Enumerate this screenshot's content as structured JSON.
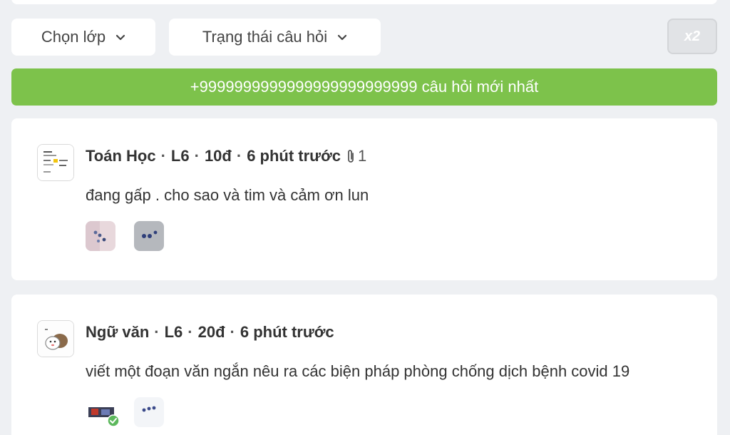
{
  "filters": {
    "class_label": "Chọn lớp",
    "status_label": "Trạng thái câu hỏi",
    "x2_label": "x2"
  },
  "banner": {
    "text": "+9999999999999999999999999 câu hỏi mới nhất"
  },
  "questions": [
    {
      "subject": "Toán Học",
      "grade": "L6",
      "points": "10đ",
      "time": "6 phút trước",
      "attachments": "1",
      "text": "đang gấp . cho sao và tim và cảm ơn lun"
    },
    {
      "subject": "Ngữ văn",
      "grade": "L6",
      "points": "20đ",
      "time": "6 phút trước",
      "text": "viết một đoạn văn ngắn nêu ra các biện pháp phòng chống dịch bệnh covid 19"
    }
  ],
  "colors": {
    "banner_green": "#7dc24b",
    "background": "#eef0f3",
    "verified_green": "#5cb85c"
  }
}
